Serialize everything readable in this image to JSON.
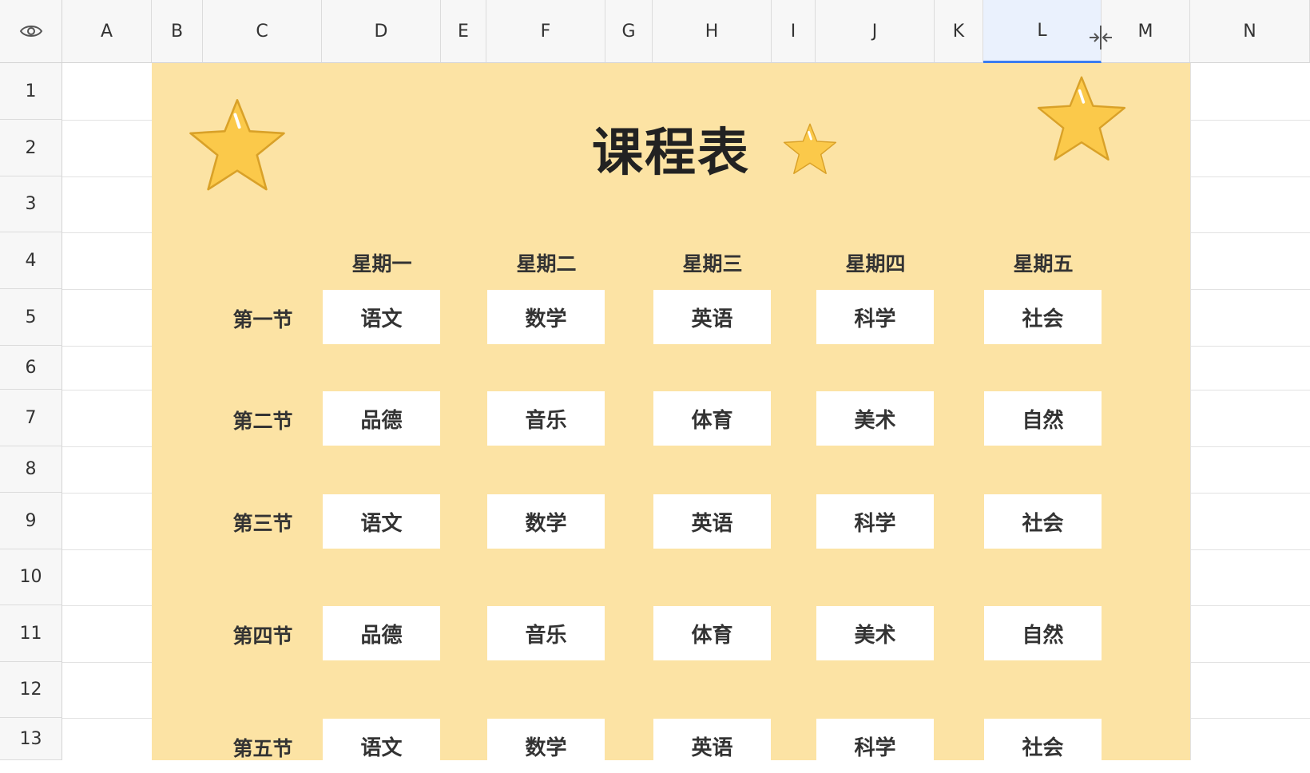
{
  "columns": [
    "A",
    "B",
    "C",
    "D",
    "E",
    "F",
    "G",
    "H",
    "I",
    "J",
    "K",
    "L",
    "M",
    "N"
  ],
  "selected_column": "L",
  "rows": [
    "1",
    "2",
    "3",
    "4",
    "5",
    "6",
    "7",
    "8",
    "9",
    "10",
    "11",
    "12",
    "13"
  ],
  "schedule": {
    "title": "课程表",
    "days": [
      "星期一",
      "星期二",
      "星期三",
      "星期四",
      "星期五"
    ],
    "periods": [
      {
        "label": "第一节",
        "subjects": [
          "语文",
          "数学",
          "英语",
          "科学",
          "社会"
        ]
      },
      {
        "label": "第二节",
        "subjects": [
          "品德",
          "音乐",
          "体育",
          "美术",
          "自然"
        ]
      },
      {
        "label": "第三节",
        "subjects": [
          "语文",
          "数学",
          "英语",
          "科学",
          "社会"
        ]
      },
      {
        "label": "第四节",
        "subjects": [
          "品德",
          "音乐",
          "体育",
          "美术",
          "自然"
        ]
      },
      {
        "label": "第五节",
        "subjects": [
          "语文",
          "数学",
          "英语",
          "科学",
          "社会"
        ]
      }
    ]
  },
  "colors": {
    "panel_bg": "#fce3a4",
    "star_fill": "#fbc94a",
    "selected_accent": "#3b7cf0"
  },
  "icons": {
    "corner": "eye-icon",
    "column_resize": "column-resize-icon"
  }
}
